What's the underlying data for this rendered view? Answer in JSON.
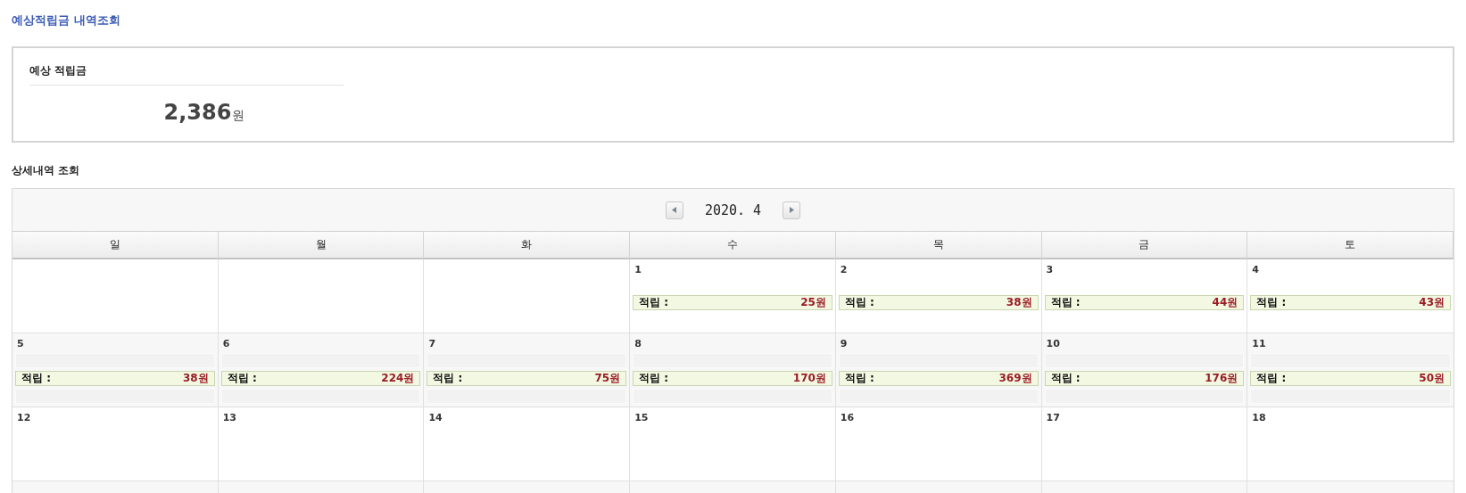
{
  "page_title": "예상적립금 내역조회",
  "summary": {
    "label": "예상 적립금",
    "amount": "2,386",
    "unit": "원"
  },
  "detail_title": "상세내역 조회",
  "calendar": {
    "month": "2020. 4",
    "weekdays": [
      "일",
      "월",
      "화",
      "수",
      "목",
      "금",
      "토"
    ],
    "weeks": [
      {
        "days": [
          {
            "kind": "blank"
          },
          {
            "kind": "blank"
          },
          {
            "kind": "blank"
          },
          {
            "kind": "day",
            "day": "1",
            "entry": {
              "label": "적립 :",
              "amount": "25원"
            }
          },
          {
            "kind": "day",
            "day": "2",
            "entry": {
              "label": "적립 :",
              "amount": "38원"
            }
          },
          {
            "kind": "day",
            "day": "3",
            "entry": {
              "label": "적립 :",
              "amount": "44원"
            }
          },
          {
            "kind": "day",
            "day": "4",
            "entry": {
              "label": "적립 :",
              "amount": "43원"
            }
          }
        ]
      },
      {
        "days": [
          {
            "kind": "day",
            "day": "5",
            "entry": {
              "label": "적립 :",
              "amount": "38원"
            }
          },
          {
            "kind": "day",
            "day": "6",
            "entry": {
              "label": "적립 :",
              "amount": "224원"
            }
          },
          {
            "kind": "day",
            "day": "7",
            "entry": {
              "label": "적립 :",
              "amount": "75원"
            }
          },
          {
            "kind": "day",
            "day": "8",
            "entry": {
              "label": "적립 :",
              "amount": "170원"
            }
          },
          {
            "kind": "day",
            "day": "9",
            "entry": {
              "label": "적립 :",
              "amount": "369원"
            }
          },
          {
            "kind": "day",
            "day": "10",
            "entry": {
              "label": "적립 :",
              "amount": "176원"
            }
          },
          {
            "kind": "day",
            "day": "11",
            "entry": {
              "label": "적립 :",
              "amount": "50원"
            }
          }
        ]
      },
      {
        "days": [
          {
            "kind": "day",
            "day": "12"
          },
          {
            "kind": "day",
            "day": "13"
          },
          {
            "kind": "day",
            "day": "14"
          },
          {
            "kind": "day",
            "day": "15"
          },
          {
            "kind": "day",
            "day": "16"
          },
          {
            "kind": "day",
            "day": "17"
          },
          {
            "kind": "day",
            "day": "18"
          }
        ]
      },
      {
        "days": [
          {
            "kind": "blank"
          },
          {
            "kind": "blank"
          },
          {
            "kind": "blank"
          },
          {
            "kind": "blank"
          },
          {
            "kind": "blank"
          },
          {
            "kind": "blank"
          },
          {
            "kind": "blank"
          }
        ]
      }
    ]
  }
}
